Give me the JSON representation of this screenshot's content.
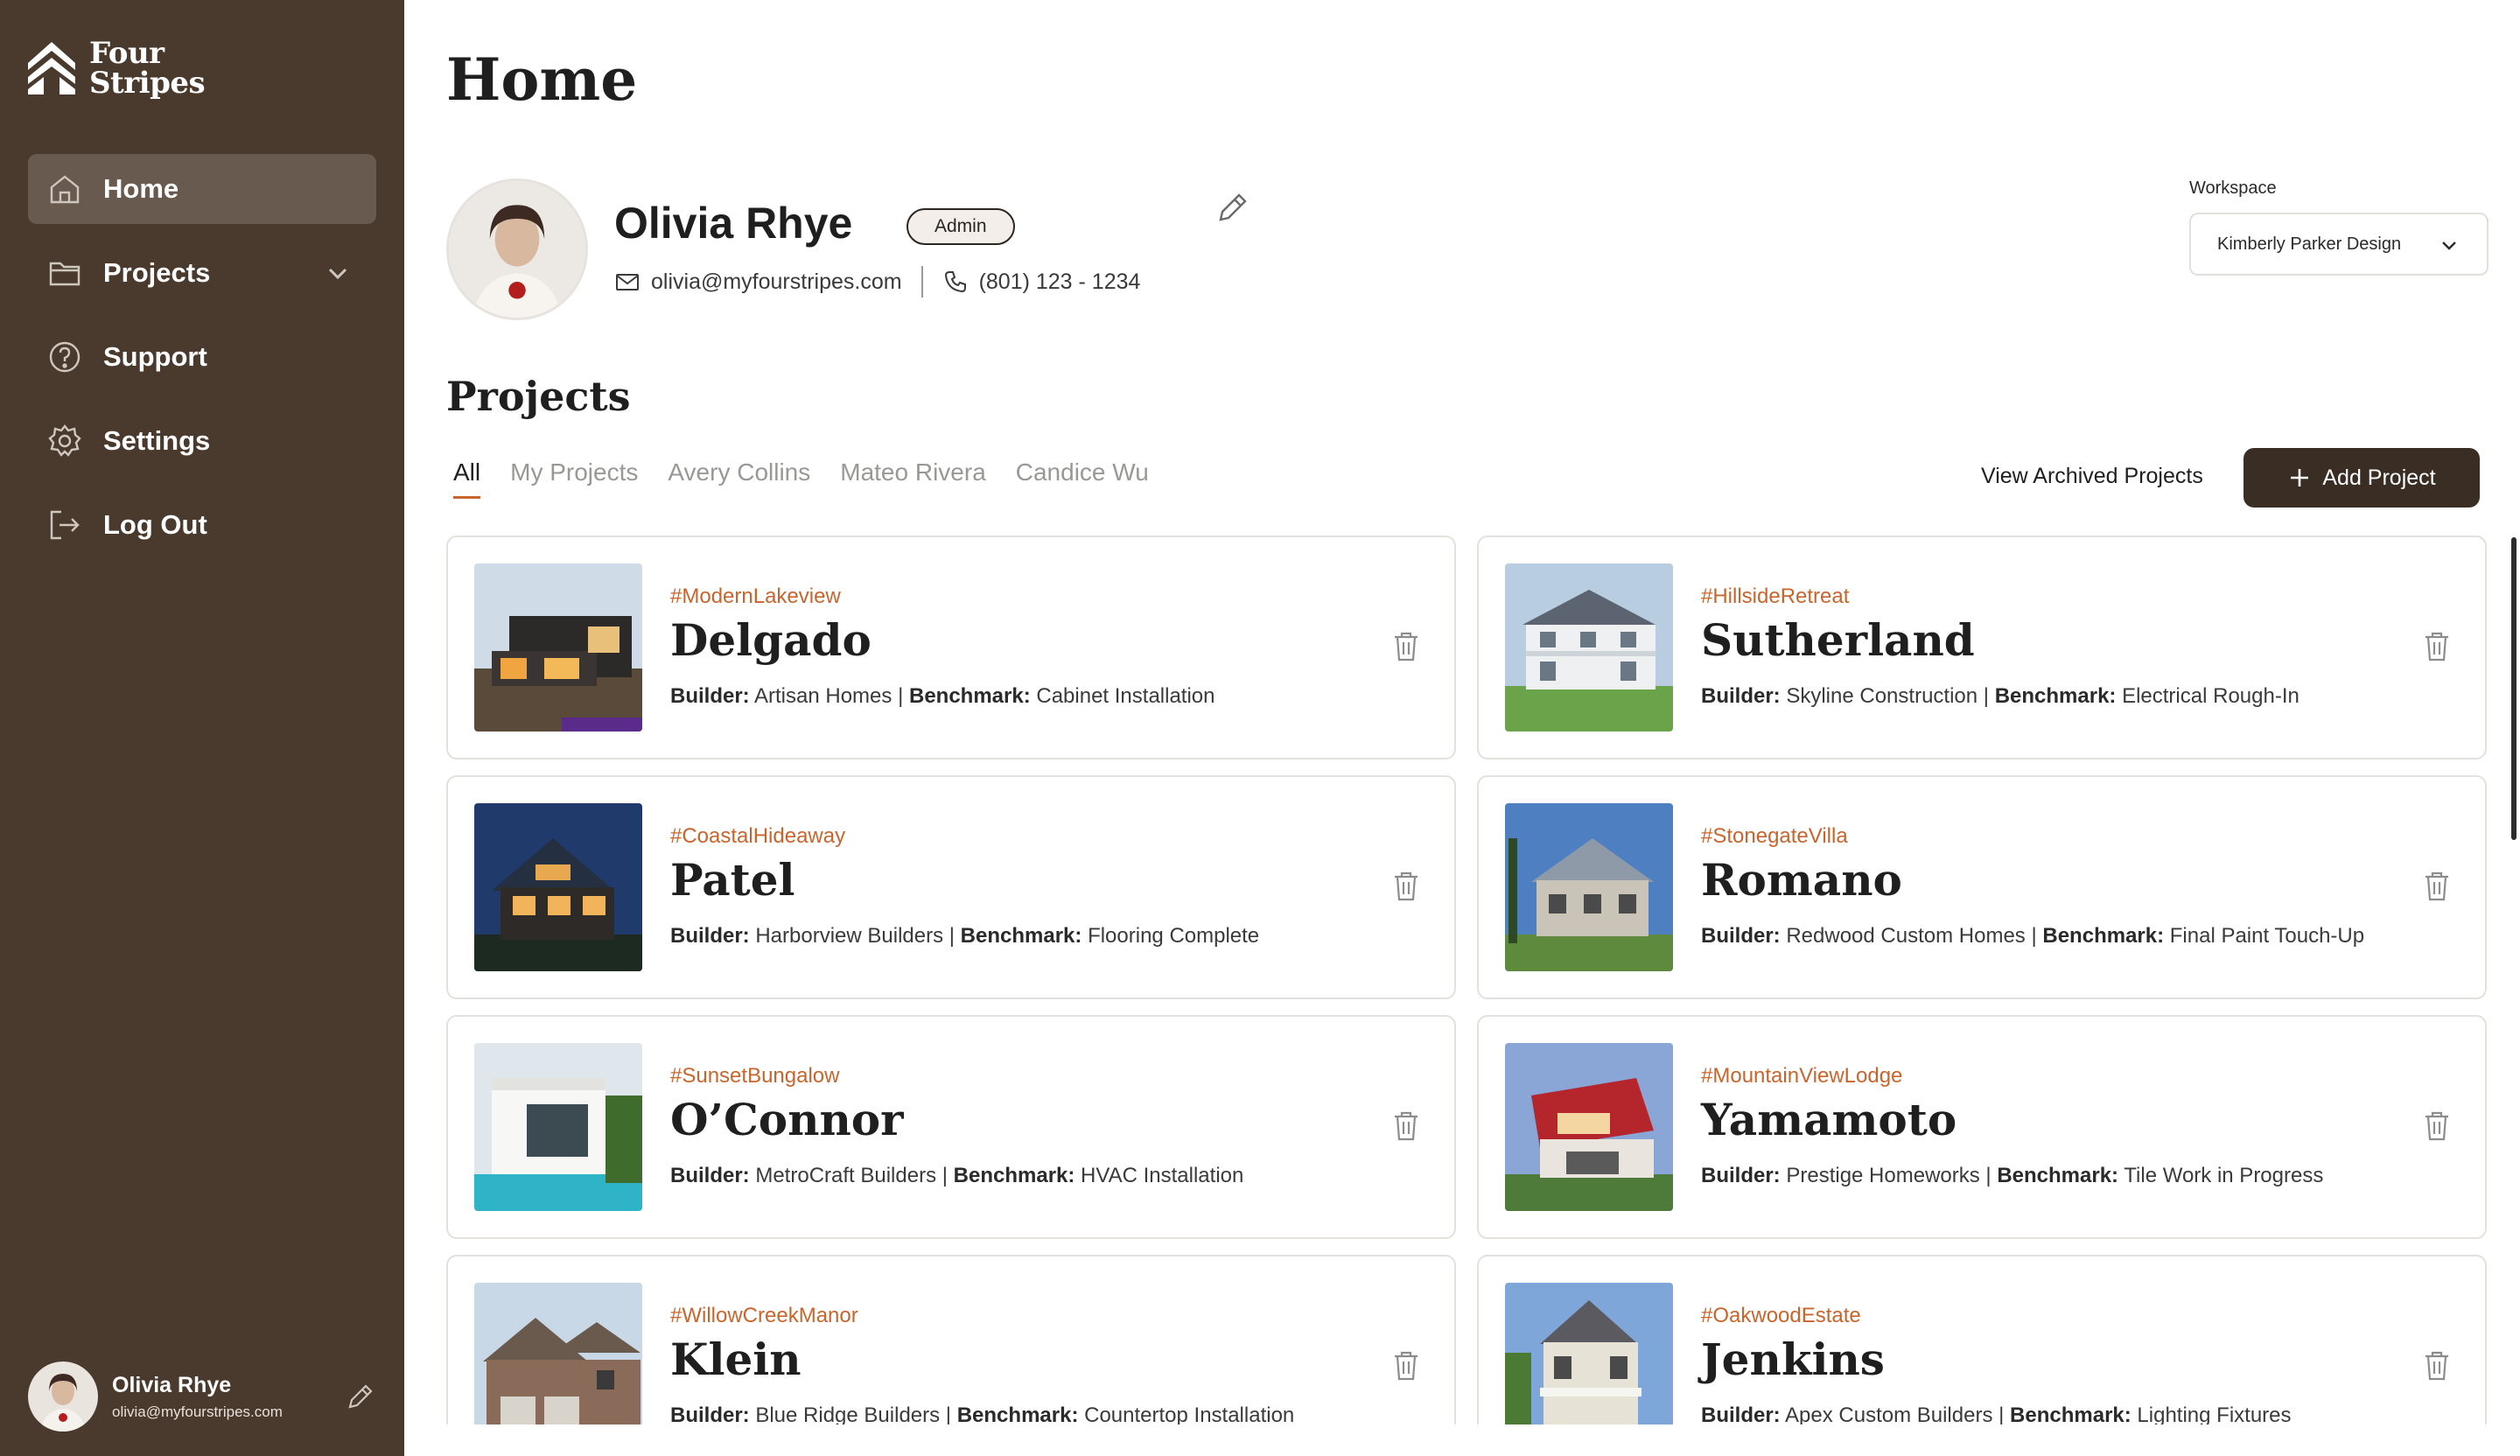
{
  "brand": {
    "line1": "Four",
    "line2": "Stripes"
  },
  "nav": [
    {
      "label": "Home",
      "icon": "home-icon",
      "active": true
    },
    {
      "label": "Projects",
      "icon": "folder-icon",
      "active": false
    },
    {
      "label": "Support",
      "icon": "help-icon",
      "active": false
    },
    {
      "label": "Settings",
      "icon": "gear-icon",
      "active": false
    },
    {
      "label": "Log Out",
      "icon": "logout-icon",
      "active": false
    }
  ],
  "sidebar_user": {
    "name": "Olivia Rhye",
    "email": "olivia@myfourstripes.com"
  },
  "page": {
    "title": "Home"
  },
  "profile": {
    "name": "Olivia Rhye",
    "role": "Admin",
    "email": "olivia@myfourstripes.com",
    "phone": "(801) 123 - 1234"
  },
  "workspace": {
    "label": "Workspace",
    "value": "Kimberly Parker Design"
  },
  "projects": {
    "title": "Projects",
    "tabs": [
      "All",
      "My Projects",
      "Avery Collins",
      "Mateo Rivera",
      "Candice Wu"
    ],
    "archived_label": "View Archived Projects",
    "add_label": "Add Project",
    "builder_label": "Builder:",
    "benchmark_label": "Benchmark:",
    "items": [
      {
        "tag": "#ModernLakeview",
        "name": "Delgado",
        "builder": "Artisan Homes",
        "benchmark": "Cabinet Installation"
      },
      {
        "tag": "#HillsideRetreat",
        "name": "Sutherland",
        "builder": "Skyline Construction",
        "benchmark": "Electrical Rough-In"
      },
      {
        "tag": "#CoastalHideaway",
        "name": "Patel",
        "builder": "Harborview Builders",
        "benchmark": "Flooring Complete"
      },
      {
        "tag": "#StonegateVilla",
        "name": "Romano",
        "builder": "Redwood Custom Homes",
        "benchmark": "Final Paint Touch-Up"
      },
      {
        "tag": "#SunsetBungalow",
        "name": "O’Connor",
        "builder": "MetroCraft Builders",
        "benchmark": "HVAC Installation"
      },
      {
        "tag": "#MountainViewLodge",
        "name": "Yamamoto",
        "builder": "Prestige Homeworks",
        "benchmark": "Tile Work in Progress"
      },
      {
        "tag": "#WillowCreekManor",
        "name": "Klein",
        "builder": "Blue Ridge Builders",
        "benchmark": "Countertop Installation"
      },
      {
        "tag": "#OakwoodEstate",
        "name": "Jenkins",
        "builder": "Apex Custom Builders",
        "benchmark": "Lighting Fixtures"
      }
    ]
  },
  "colors": {
    "sidebar": "#4a3a2d",
    "accent": "#c9652c",
    "button": "#3a2d23"
  }
}
